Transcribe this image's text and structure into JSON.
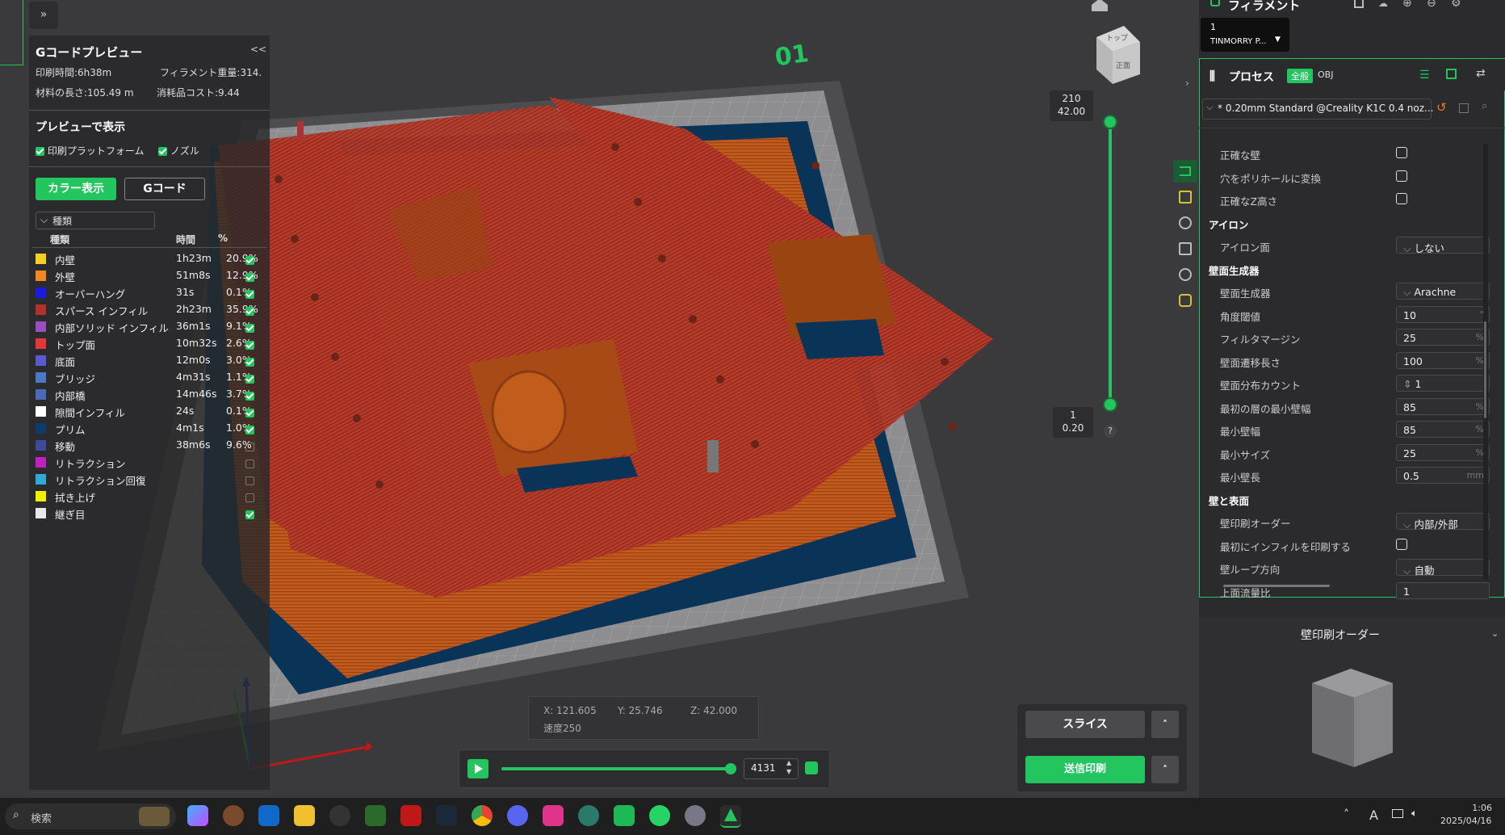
{
  "preview": {
    "title": "Gコードプレビュー",
    "collapse": "<<",
    "print_time": "印刷時間:6h38m",
    "filament_weight": "フィラメント重量:314.",
    "filament_length": "材料の長さ:105.49 m",
    "cost": "消耗品コスト:9.44",
    "show_title": "プレビューで表示",
    "show_platform": "印刷プラットフォーム",
    "show_nozzle": "ノズル",
    "btn_color": "カラー表示",
    "btn_gcode": "Gコード",
    "type_dropdown": "種類",
    "col_type": "種類",
    "col_time": "時間",
    "col_pct": "%",
    "legend": [
      {
        "name": "内壁",
        "time": "1h23m",
        "pct": "20.9%",
        "color": "#f5d020",
        "checked": true
      },
      {
        "name": "外壁",
        "time": "51m8s",
        "pct": "12.9%",
        "color": "#f08a20",
        "checked": true
      },
      {
        "name": "オーバーハング",
        "time": "31s",
        "pct": "0.1%",
        "color": "#1a1ae0",
        "checked": true
      },
      {
        "name": "スパース インフィル",
        "time": "2h23m",
        "pct": "35.9%",
        "color": "#b0312d",
        "checked": true
      },
      {
        "name": "内部ソリッド インフィル",
        "time": "36m1s",
        "pct": "9.1%",
        "color": "#9a4fc0",
        "checked": true
      },
      {
        "name": "トップ面",
        "time": "10m32s",
        "pct": "2.6%",
        "color": "#e03838",
        "checked": true
      },
      {
        "name": "底面",
        "time": "12m0s",
        "pct": "3.0%",
        "color": "#5a5ad0",
        "checked": true
      },
      {
        "name": "ブリッジ",
        "time": "4m31s",
        "pct": "1.1%",
        "color": "#4c78c8",
        "checked": true
      },
      {
        "name": "内部橋",
        "time": "14m46s",
        "pct": "3.7%",
        "color": "#4a6ab4",
        "checked": true
      },
      {
        "name": "隙間インフィル",
        "time": "24s",
        "pct": "0.1%",
        "color": "#ffffff",
        "checked": true
      },
      {
        "name": "プリム",
        "time": "4m1s",
        "pct": "1.0%",
        "color": "#0a3d6e",
        "checked": true
      },
      {
        "name": "移動",
        "time": "38m6s",
        "pct": "9.6%",
        "color": "#3e4a9a",
        "checked": false
      },
      {
        "name": "リトラクション",
        "time": "",
        "pct": "",
        "color": "#c020c0",
        "checked": false
      },
      {
        "name": "リトラクション回復",
        "time": "",
        "pct": "",
        "color": "#30a8d8",
        "checked": false
      },
      {
        "name": "拭き上げ",
        "time": "",
        "pct": "",
        "color": "#f0f000",
        "checked": false
      },
      {
        "name": "継ぎ目",
        "time": "",
        "pct": "",
        "color": "#e8e8e8",
        "checked": true
      }
    ]
  },
  "viewport": {
    "plate_label": "01",
    "cube_top": "トップ",
    "cube_front": "正面",
    "layer_top_1": "210",
    "layer_top_2": "42.00",
    "layer_bottom_1": "1",
    "layer_bottom_2": "0.20",
    "help": "?",
    "coord_x": "X: 121.605",
    "coord_y": "Y: 25.746",
    "coord_z": "Z: 42.000",
    "speed": "速度250",
    "move_value": "4131",
    "progress": 1.0,
    "layer_fraction": 1.0
  },
  "actions": {
    "slice": "スライス",
    "send": "送信印刷",
    "caret": "˄"
  },
  "right": {
    "filament_header": "フィラメント",
    "filament_slot_num": "1",
    "filament_slot_name": "TINMORRY P...",
    "process_title": "プロセス",
    "tag_all": "全般",
    "tag_obj": "OBJ",
    "profile": "* 0.20mm Standard @Creality K1C 0.4 noz...",
    "settings": [
      {
        "kind": "check",
        "label": "正確な壁"
      },
      {
        "kind": "check",
        "label": "穴をポリホールに変換"
      },
      {
        "kind": "check",
        "label": "正確なZ高さ"
      },
      {
        "kind": "section",
        "label": "アイロン"
      },
      {
        "kind": "select",
        "label": "アイロン面",
        "value": "しない",
        "unit": ""
      },
      {
        "kind": "section",
        "label": "壁面生成器"
      },
      {
        "kind": "select",
        "label": "壁面生成器",
        "value": "Arachne",
        "unit": ""
      },
      {
        "kind": "input",
        "label": "角度閾値",
        "value": "10",
        "unit": "°"
      },
      {
        "kind": "input",
        "label": "フィルタマージン",
        "value": "25",
        "unit": "%"
      },
      {
        "kind": "input",
        "label": "壁面遷移長さ",
        "value": "100",
        "unit": "%"
      },
      {
        "kind": "spin",
        "label": "壁面分布カウント",
        "value": "1",
        "unit": ""
      },
      {
        "kind": "input",
        "label": "最初の層の最小壁幅",
        "value": "85",
        "unit": "%"
      },
      {
        "kind": "input",
        "label": "最小壁幅",
        "value": "85",
        "unit": "%"
      },
      {
        "kind": "input",
        "label": "最小サイズ",
        "value": "25",
        "unit": "%"
      },
      {
        "kind": "input",
        "label": "最小壁長",
        "value": "0.5",
        "unit": "mm"
      },
      {
        "kind": "section",
        "label": "壁と表面"
      },
      {
        "kind": "select",
        "label": "壁印刷オーダー",
        "value": "内部/外部",
        "unit": ""
      },
      {
        "kind": "check",
        "label": "最初にインフィルを印刷する"
      },
      {
        "kind": "select",
        "label": "壁ループ方向",
        "value": "自動",
        "unit": ""
      },
      {
        "kind": "input",
        "label": "上面流量比",
        "value": "1",
        "unit": ""
      }
    ],
    "help_title": "壁印刷オーダー"
  },
  "taskbar": {
    "search": "検索",
    "time": "1:06",
    "date": "2025/04/16",
    "ime": "A"
  }
}
